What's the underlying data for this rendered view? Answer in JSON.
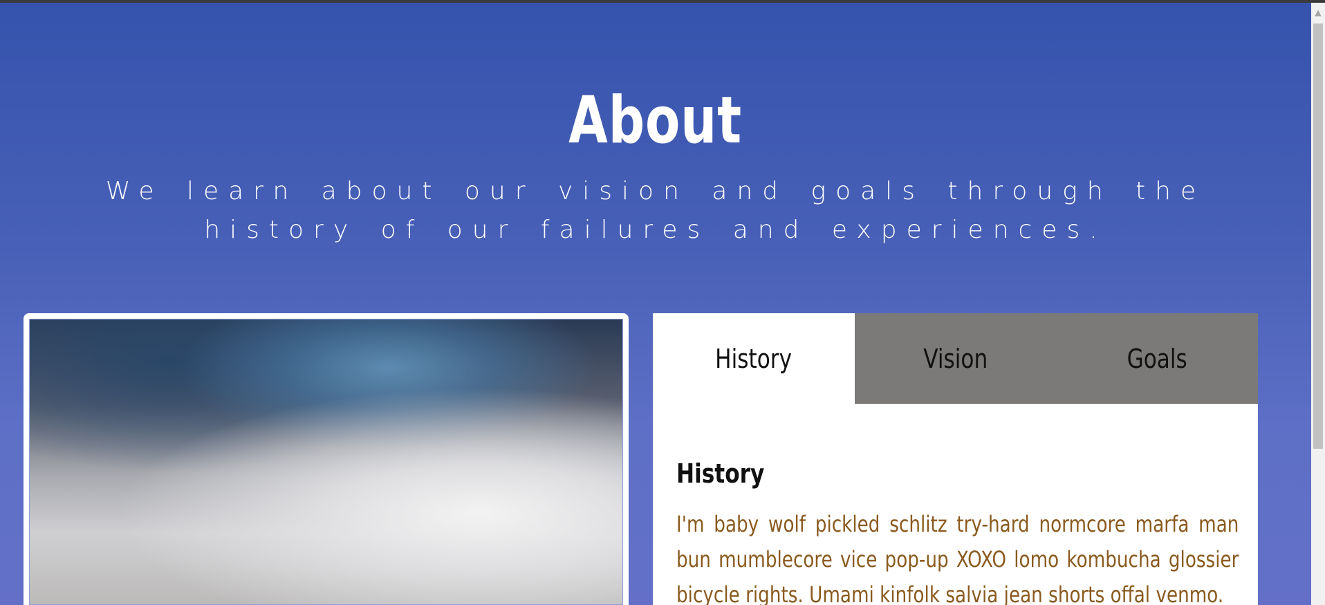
{
  "hero": {
    "title": "About",
    "subtitle": "We learn about our vision and goals through the history of our failures and experiences."
  },
  "tabs": [
    {
      "label": "History",
      "active": true
    },
    {
      "label": "Vision",
      "active": false
    },
    {
      "label": "Goals",
      "active": false
    }
  ],
  "panel": {
    "heading": "History",
    "text": "I'm baby wolf pickled schlitz try-hard normcore marfa man bun mumblecore vice pop-up XOXO lomo kombucha glossier bicycle rights. Umami kinfolk salvia jean shorts offal venmo."
  },
  "image": {
    "icon": "blurred-sky-photo"
  },
  "colors": {
    "hero_top": "#3553ad",
    "hero_bottom": "#6470c8",
    "tab_inactive": "#7b7a79",
    "tab_active": "#ffffff",
    "panel_text": "#8a5a1e"
  }
}
